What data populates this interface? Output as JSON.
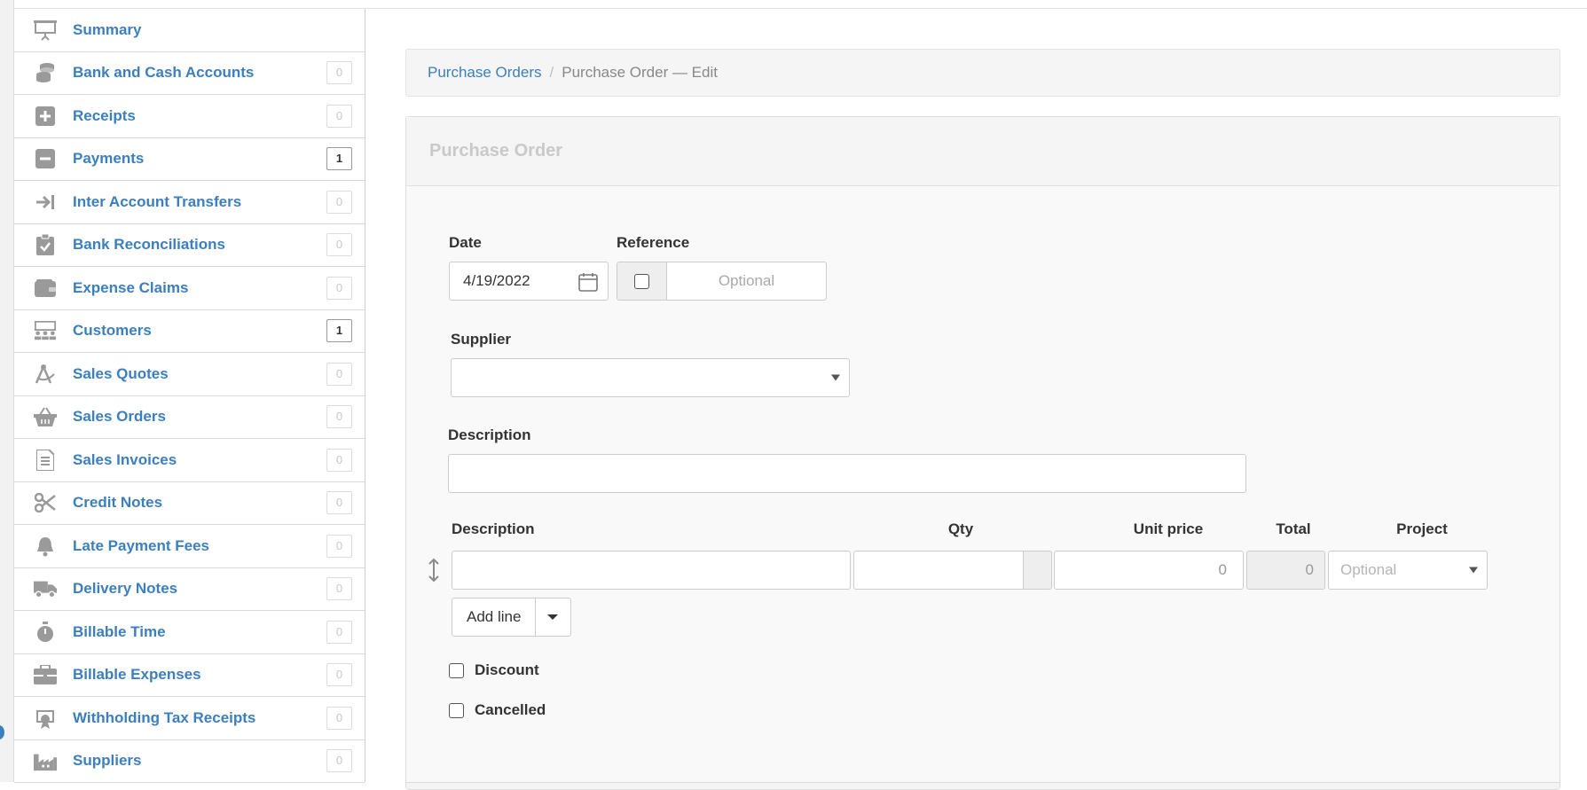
{
  "sidebar": {
    "items": [
      {
        "label": "Summary",
        "icon": "presentation-board-icon",
        "badge": ""
      },
      {
        "label": "Bank and Cash Accounts",
        "icon": "coins-icon",
        "badge": "0"
      },
      {
        "label": "Receipts",
        "icon": "plus-square-icon",
        "badge": "0"
      },
      {
        "label": "Payments",
        "icon": "minus-square-icon",
        "badge": "1"
      },
      {
        "label": "Inter Account Transfers",
        "icon": "transfer-arrow-icon",
        "badge": "0"
      },
      {
        "label": "Bank Reconciliations",
        "icon": "clipboard-check-icon",
        "badge": "0"
      },
      {
        "label": "Expense Claims",
        "icon": "wallet-icon",
        "badge": "0"
      },
      {
        "label": "Customers",
        "icon": "people-icon",
        "badge": "1"
      },
      {
        "label": "Sales Quotes",
        "icon": "compass-icon",
        "badge": "0"
      },
      {
        "label": "Sales Orders",
        "icon": "basket-icon",
        "badge": "0"
      },
      {
        "label": "Sales Invoices",
        "icon": "invoice-document-icon",
        "badge": "0"
      },
      {
        "label": "Credit Notes",
        "icon": "scissors-icon",
        "badge": "0"
      },
      {
        "label": "Late Payment Fees",
        "icon": "bell-icon",
        "badge": "0"
      },
      {
        "label": "Delivery Notes",
        "icon": "truck-icon",
        "badge": "0"
      },
      {
        "label": "Billable Time",
        "icon": "stopwatch-icon",
        "badge": "0"
      },
      {
        "label": "Billable Expenses",
        "icon": "briefcase-icon",
        "badge": "0"
      },
      {
        "label": "Withholding Tax Receipts",
        "icon": "tax-receipt-icon",
        "badge": "0"
      },
      {
        "label": "Suppliers",
        "icon": "factory-icon",
        "badge": "0"
      }
    ]
  },
  "breadcrumb": {
    "parent": "Purchase Orders",
    "separator": "/",
    "current": "Purchase Order — Edit"
  },
  "form": {
    "title": "Purchase Order",
    "date_label": "Date",
    "date_value": "4/19/2022",
    "reference_label": "Reference",
    "reference_placeholder": "Optional",
    "supplier_label": "Supplier",
    "description_label": "Description",
    "lines": {
      "headers": {
        "description": "Description",
        "qty": "Qty",
        "unit_price": "Unit price",
        "total": "Total",
        "project": "Project"
      },
      "row": {
        "description": "",
        "qty": "",
        "unit_price": "0",
        "total": "0",
        "project_placeholder": "Optional"
      },
      "add_line_label": "Add line"
    },
    "discount_label": "Discount",
    "cancelled_label": "Cancelled"
  }
}
